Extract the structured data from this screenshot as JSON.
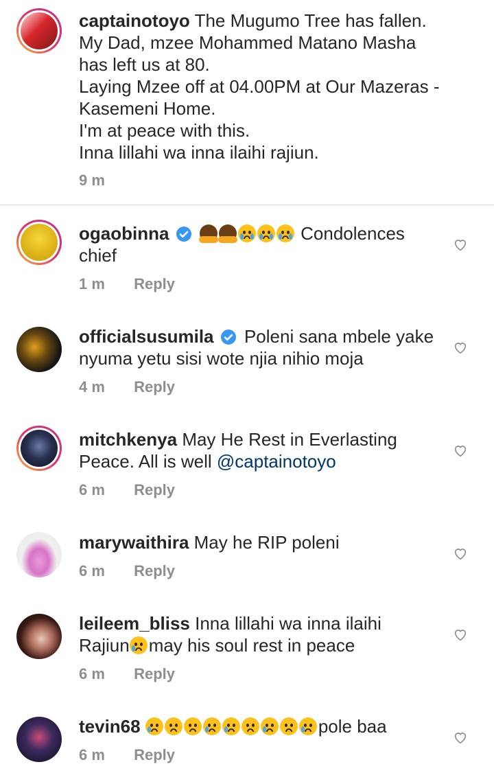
{
  "post": {
    "username": "captainotoyo",
    "lines": [
      "The Mugumo Tree has fallen.",
      "My Dad, mzee Mohammed Matano Masha",
      "has left us at 80.",
      "Laying Mzee off at 04.00PM at Our Mazeras -",
      "Kasemeni Home.",
      "I'm at peace with this.",
      "Inna lillahi wa inna ilaihi rajiun."
    ],
    "time": "9 m"
  },
  "reply_label": "Reply",
  "comments": [
    {
      "username": "ogaobinna",
      "verified": true,
      "text_line1": "Condolences",
      "text_line2": "chief",
      "time": "1 m"
    },
    {
      "username": "officialsusumila",
      "verified": true,
      "text_line1": "Poleni sana mbele yake",
      "text_line2": "nyuma yetu sisi wote njia nihio moja",
      "time": "4 m"
    },
    {
      "username": "mitchkenya",
      "verified": false,
      "text_line1": "May He Rest in Everlasting",
      "text_line2": "Peace. All is well",
      "mention": "@captainotoyo",
      "time": "6 m"
    },
    {
      "username": "marywaithira",
      "verified": false,
      "text_line1": "May he RIP poleni",
      "time": "6 m"
    },
    {
      "username": "leileem_bliss",
      "verified": false,
      "text_line1": "Inna lillahi wa inna ilaihi",
      "text_line2a": "Rajiun",
      "text_line2b": "may his soul rest in peace",
      "time": "6 m"
    },
    {
      "username": "tevin68",
      "verified": false,
      "text_line1": "pole baa",
      "time": "6 m"
    }
  ],
  "colors": {
    "meta": "#8e8e8e",
    "verified": "#3897f0",
    "mention": "#00376b",
    "divider": "#dbdbdb"
  }
}
